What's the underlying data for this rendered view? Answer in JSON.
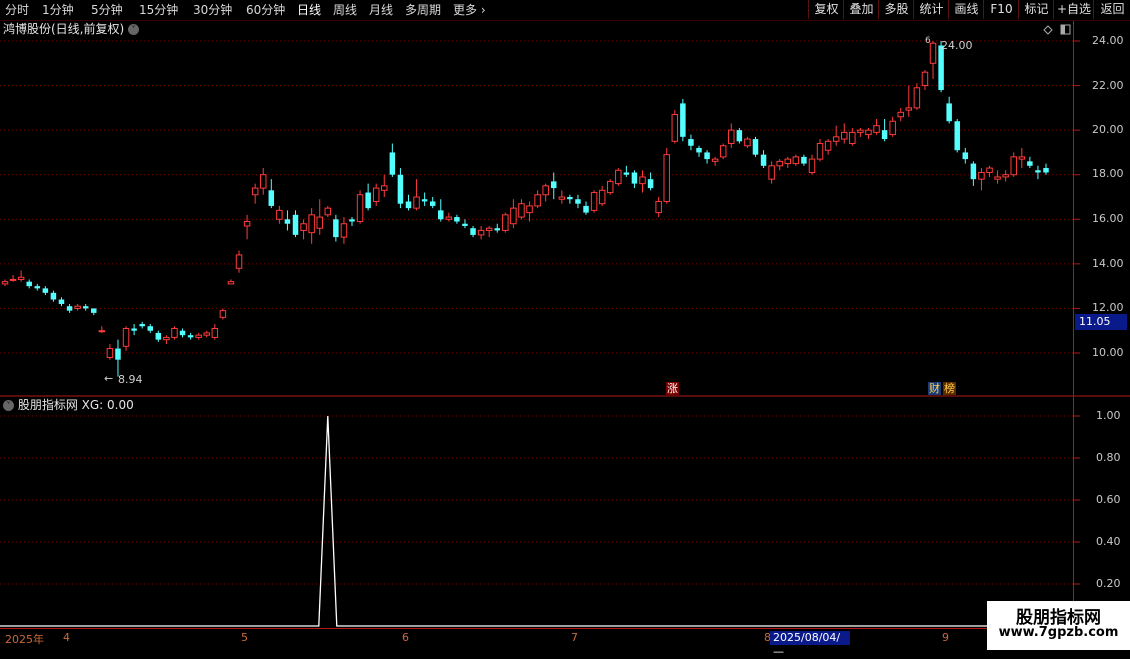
{
  "toolbar": {
    "periods": [
      "分时",
      "1分钟",
      "5分钟",
      "15分钟",
      "30分钟",
      "60分钟",
      "日线",
      "周线",
      "月线",
      "多周期",
      "更多"
    ],
    "more_arrow": "›",
    "active_period": "日线",
    "right_buttons": [
      "复权",
      "叠加",
      "多股",
      "统计",
      "画线",
      "F10",
      "标记",
      "+自选",
      "返回"
    ]
  },
  "main_header": {
    "title": "鸿博股份(日线,前复权)",
    "chevron": "˅"
  },
  "indicator_header": {
    "title": "股朋指标网 XG: 0.00",
    "chevron": "˅"
  },
  "price_axis": {
    "ticks": [
      "24.00",
      "22.00",
      "20.00",
      "18.00",
      "16.00",
      "14.00",
      "12.00",
      "10.00"
    ],
    "current_price": "11.05"
  },
  "indicator_axis": {
    "ticks": [
      "1.00",
      "0.80",
      "0.60",
      "0.40",
      "0.20"
    ]
  },
  "annotations": {
    "high": "24.00",
    "low": "8.94",
    "high_marker": "6"
  },
  "tags": {
    "zhang": "涨",
    "cai": "财",
    "bang": "榜"
  },
  "x_axis": {
    "labels": [
      "2025年",
      "4",
      "5",
      "6",
      "7",
      "8",
      "9"
    ],
    "cursor_date": "2025/08/04/—"
  },
  "watermark": {
    "name": "股朋指标网",
    "url": "www.7gpzb.com"
  },
  "colors": {
    "up": "#ff3b3b",
    "down": "#54ffff",
    "grid": "#7a0000",
    "frame": "#b01818",
    "line": "#ffffff"
  },
  "chart_data": {
    "type": "candlestick",
    "ylim": [
      8.5,
      24.6
    ],
    "candles": [
      [
        13.1,
        13.3,
        13.0,
        13.2
      ],
      [
        13.3,
        13.5,
        13.2,
        13.3
      ],
      [
        13.3,
        13.7,
        13.2,
        13.4
      ],
      [
        13.2,
        13.3,
        12.9,
        13.0
      ],
      [
        13.0,
        13.1,
        12.8,
        12.9
      ],
      [
        12.9,
        13.0,
        12.6,
        12.7
      ],
      [
        12.7,
        12.8,
        12.3,
        12.4
      ],
      [
        12.4,
        12.5,
        12.1,
        12.2
      ],
      [
        12.1,
        12.2,
        11.8,
        11.9
      ],
      [
        12.0,
        12.2,
        11.9,
        12.1
      ],
      [
        12.1,
        12.2,
        11.9,
        12.0
      ],
      [
        12.0,
        12.0,
        11.7,
        11.8
      ],
      [
        11.0,
        11.2,
        10.9,
        11.0
      ],
      [
        9.8,
        10.4,
        9.7,
        10.2
      ],
      [
        10.2,
        10.6,
        8.94,
        9.7
      ],
      [
        10.3,
        11.2,
        10.1,
        11.1
      ],
      [
        11.1,
        11.3,
        10.8,
        11.0
      ],
      [
        11.3,
        11.4,
        11.1,
        11.2
      ],
      [
        11.2,
        11.3,
        10.9,
        11.0
      ],
      [
        10.9,
        11.0,
        10.5,
        10.6
      ],
      [
        10.6,
        10.8,
        10.4,
        10.7
      ],
      [
        10.7,
        11.2,
        10.6,
        11.1
      ],
      [
        11.0,
        11.1,
        10.7,
        10.8
      ],
      [
        10.8,
        10.9,
        10.6,
        10.7
      ],
      [
        10.7,
        10.9,
        10.6,
        10.8
      ],
      [
        10.8,
        11.0,
        10.7,
        10.9
      ],
      [
        10.7,
        11.3,
        10.6,
        11.1
      ],
      [
        11.6,
        12.0,
        11.5,
        11.9
      ],
      [
        13.1,
        13.3,
        13.1,
        13.2
      ],
      [
        13.8,
        14.6,
        13.6,
        14.4
      ],
      [
        15.7,
        16.2,
        15.1,
        15.9
      ],
      [
        17.1,
        17.6,
        16.7,
        17.4
      ],
      [
        17.4,
        18.3,
        17.1,
        18.0
      ],
      [
        17.3,
        17.8,
        16.5,
        16.6
      ],
      [
        16.0,
        16.6,
        15.8,
        16.4
      ],
      [
        16.0,
        16.4,
        15.5,
        15.8
      ],
      [
        16.2,
        16.4,
        15.2,
        15.3
      ],
      [
        15.5,
        16.0,
        15.1,
        15.8
      ],
      [
        15.4,
        16.5,
        14.9,
        16.2
      ],
      [
        15.6,
        16.9,
        15.3,
        16.1
      ],
      [
        16.2,
        16.6,
        16.1,
        16.5
      ],
      [
        16.0,
        16.2,
        15.0,
        15.2
      ],
      [
        15.2,
        16.1,
        14.9,
        15.8
      ],
      [
        16.0,
        16.1,
        15.7,
        15.9
      ],
      [
        15.9,
        17.3,
        15.8,
        17.1
      ],
      [
        17.2,
        17.6,
        16.4,
        16.5
      ],
      [
        16.8,
        17.6,
        16.6,
        17.4
      ],
      [
        17.3,
        18.0,
        17.0,
        17.5
      ],
      [
        19.0,
        19.4,
        17.9,
        18.0
      ],
      [
        18.0,
        18.3,
        16.5,
        16.7
      ],
      [
        16.8,
        17.1,
        16.4,
        16.5
      ],
      [
        16.5,
        17.8,
        16.4,
        17.0
      ],
      [
        16.9,
        17.2,
        16.6,
        16.8
      ],
      [
        16.8,
        17.0,
        16.5,
        16.6
      ],
      [
        16.4,
        16.9,
        15.9,
        16.0
      ],
      [
        16.0,
        16.3,
        15.9,
        16.1
      ],
      [
        16.1,
        16.2,
        15.8,
        15.9
      ],
      [
        15.8,
        16.0,
        15.6,
        15.7
      ],
      [
        15.6,
        15.7,
        15.2,
        15.3
      ],
      [
        15.3,
        15.7,
        15.1,
        15.5
      ],
      [
        15.5,
        15.7,
        15.2,
        15.6
      ],
      [
        15.6,
        15.8,
        15.4,
        15.5
      ],
      [
        15.5,
        16.3,
        15.4,
        16.2
      ],
      [
        15.8,
        16.9,
        15.6,
        16.5
      ],
      [
        16.1,
        16.9,
        16.0,
        16.7
      ],
      [
        16.3,
        16.8,
        15.9,
        16.6
      ],
      [
        16.6,
        17.3,
        16.5,
        17.1
      ],
      [
        17.1,
        17.6,
        16.8,
        17.5
      ],
      [
        17.7,
        18.1,
        16.9,
        17.4
      ],
      [
        16.9,
        17.3,
        16.7,
        17.0
      ],
      [
        17.0,
        17.1,
        16.7,
        16.9
      ],
      [
        16.9,
        17.1,
        16.5,
        16.7
      ],
      [
        16.6,
        16.8,
        16.2,
        16.3
      ],
      [
        16.4,
        17.3,
        16.3,
        17.2
      ],
      [
        16.7,
        17.5,
        16.6,
        17.3
      ],
      [
        17.2,
        17.8,
        17.1,
        17.7
      ],
      [
        17.6,
        18.3,
        17.5,
        18.2
      ],
      [
        18.1,
        18.4,
        17.9,
        18.0
      ],
      [
        18.1,
        18.2,
        17.4,
        17.6
      ],
      [
        17.6,
        18.2,
        17.2,
        17.9
      ],
      [
        17.8,
        18.1,
        17.3,
        17.4
      ],
      [
        16.3,
        17.0,
        16.1,
        16.8
      ],
      [
        16.8,
        19.2,
        16.7,
        18.9
      ],
      [
        19.5,
        20.9,
        19.4,
        20.7
      ],
      [
        21.2,
        21.4,
        19.5,
        19.7
      ],
      [
        19.6,
        19.8,
        19.1,
        19.3
      ],
      [
        19.2,
        19.3,
        18.8,
        19.0
      ],
      [
        19.0,
        19.1,
        18.5,
        18.7
      ],
      [
        18.6,
        18.8,
        18.4,
        18.7
      ],
      [
        18.8,
        19.4,
        18.7,
        19.3
      ],
      [
        19.4,
        20.3,
        19.2,
        20.0
      ],
      [
        20.0,
        20.1,
        19.4,
        19.5
      ],
      [
        19.3,
        19.7,
        19.2,
        19.6
      ],
      [
        19.6,
        19.7,
        18.8,
        18.9
      ],
      [
        18.9,
        19.1,
        18.3,
        18.4
      ],
      [
        17.8,
        18.6,
        17.6,
        18.4
      ],
      [
        18.4,
        18.7,
        18.2,
        18.6
      ],
      [
        18.5,
        18.8,
        18.3,
        18.7
      ],
      [
        18.5,
        18.9,
        18.4,
        18.8
      ],
      [
        18.8,
        18.9,
        18.4,
        18.5
      ],
      [
        18.1,
        18.9,
        18.0,
        18.7
      ],
      [
        18.7,
        19.6,
        18.6,
        19.4
      ],
      [
        19.1,
        19.6,
        18.9,
        19.5
      ],
      [
        19.5,
        20.2,
        19.3,
        19.7
      ],
      [
        19.6,
        20.3,
        19.4,
        19.9
      ],
      [
        19.4,
        20.1,
        19.3,
        19.9
      ],
      [
        19.9,
        20.1,
        19.7,
        20.0
      ],
      [
        19.8,
        20.1,
        19.6,
        20.0
      ],
      [
        19.9,
        20.5,
        19.8,
        20.2
      ],
      [
        20.0,
        20.5,
        19.5,
        19.6
      ],
      [
        19.8,
        20.6,
        19.7,
        20.4
      ],
      [
        20.6,
        21.0,
        20.4,
        20.8
      ],
      [
        20.9,
        22.0,
        20.6,
        21.0
      ],
      [
        21.0,
        22.1,
        20.9,
        21.9
      ],
      [
        22.0,
        22.7,
        21.8,
        22.6
      ],
      [
        23.0,
        24.0,
        22.3,
        23.9
      ],
      [
        23.8,
        24.0,
        21.7,
        21.8
      ],
      [
        21.2,
        21.5,
        20.3,
        20.4
      ],
      [
        20.4,
        20.5,
        19.0,
        19.1
      ],
      [
        19.0,
        19.2,
        18.5,
        18.7
      ],
      [
        18.5,
        18.6,
        17.5,
        17.8
      ],
      [
        17.8,
        18.3,
        17.3,
        18.1
      ],
      [
        18.1,
        18.4,
        17.9,
        18.3
      ],
      [
        17.8,
        18.2,
        17.6,
        17.9
      ],
      [
        17.9,
        18.2,
        17.7,
        18.0
      ],
      [
        18.0,
        19.0,
        17.9,
        18.8
      ],
      [
        18.7,
        19.2,
        18.3,
        18.8
      ],
      [
        18.6,
        18.8,
        18.3,
        18.4
      ],
      [
        18.2,
        18.4,
        17.8,
        18.1
      ],
      [
        18.3,
        18.5,
        18.0,
        18.1
      ]
    ],
    "indicator_xg": {
      "values": [
        0,
        1,
        0
      ],
      "spike_index": 40
    }
  }
}
